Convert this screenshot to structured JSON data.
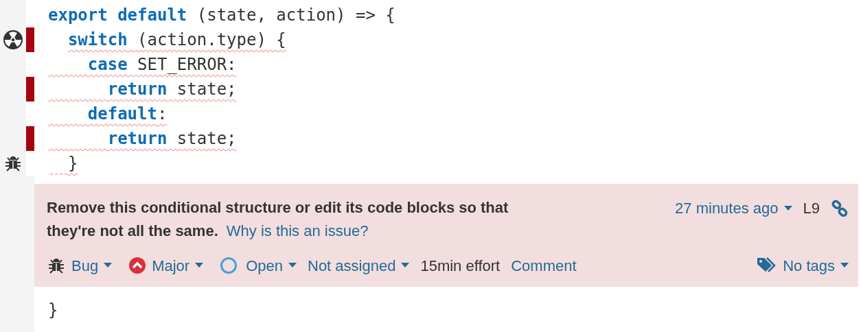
{
  "code_lines": [
    {
      "tokens": [
        {
          "kind": "keyword",
          "text": "export default"
        },
        {
          "kind": "plain",
          "text": " (state, action) => {"
        }
      ],
      "marked": false,
      "underlined": false,
      "children": [
        {
          "gutter": {
            "kind": "radiation"
          },
          "tokens": [
            {
              "kind": "keyword",
              "text": "switch"
            },
            {
              "kind": "plain",
              "text": " (action.type) {"
            }
          ],
          "marked": true,
          "underlined": true,
          "underline_indent": false,
          "children": [
            {
              "tokens": [
                {
                  "kind": "keyword",
                  "text": "case"
                },
                {
                  "kind": "plain",
                  "text": " SET_ERROR:"
                }
              ],
              "marked": false,
              "underlined": true,
              "underline_indent": true,
              "children": [
                {
                  "tokens": [
                    {
                      "kind": "keyword",
                      "text": "return"
                    },
                    {
                      "kind": "plain",
                      "text": " state;"
                    }
                  ],
                  "marked": true,
                  "underlined": true,
                  "underline_indent": true
                }
              ]
            },
            {
              "tokens": [
                {
                  "kind": "keyword",
                  "text": "default"
                },
                {
                  "kind": "plain",
                  "text": ":"
                }
              ],
              "marked": false,
              "underlined": true,
              "underline_indent": true,
              "children": [
                {
                  "tokens": [
                    {
                      "kind": "keyword",
                      "text": "return"
                    },
                    {
                      "kind": "plain",
                      "text": " state;"
                    }
                  ],
                  "marked": true,
                  "underlined": true,
                  "underline_indent": true
                }
              ]
            }
          ]
        },
        {
          "gutter": {
            "kind": "bug"
          },
          "tokens": [
            {
              "kind": "plain",
              "text": "}"
            }
          ],
          "marked": false,
          "underlined": true,
          "underline_indent": true
        }
      ]
    }
  ],
  "issue": {
    "message": "Remove this conditional structure or edit its code blocks so that they're not all the same.",
    "why_link": "Why is this an issue?",
    "time": "27 minutes ago",
    "line": "L9",
    "type": "Bug",
    "severity": "Major",
    "status": "Open",
    "assignee": "Not assigned",
    "effort": "15min effort",
    "comment": "Comment",
    "tags": "No tags"
  },
  "after_lines": [
    {
      "tokens": [
        {
          "kind": "plain",
          "text": "}"
        }
      ]
    }
  ]
}
